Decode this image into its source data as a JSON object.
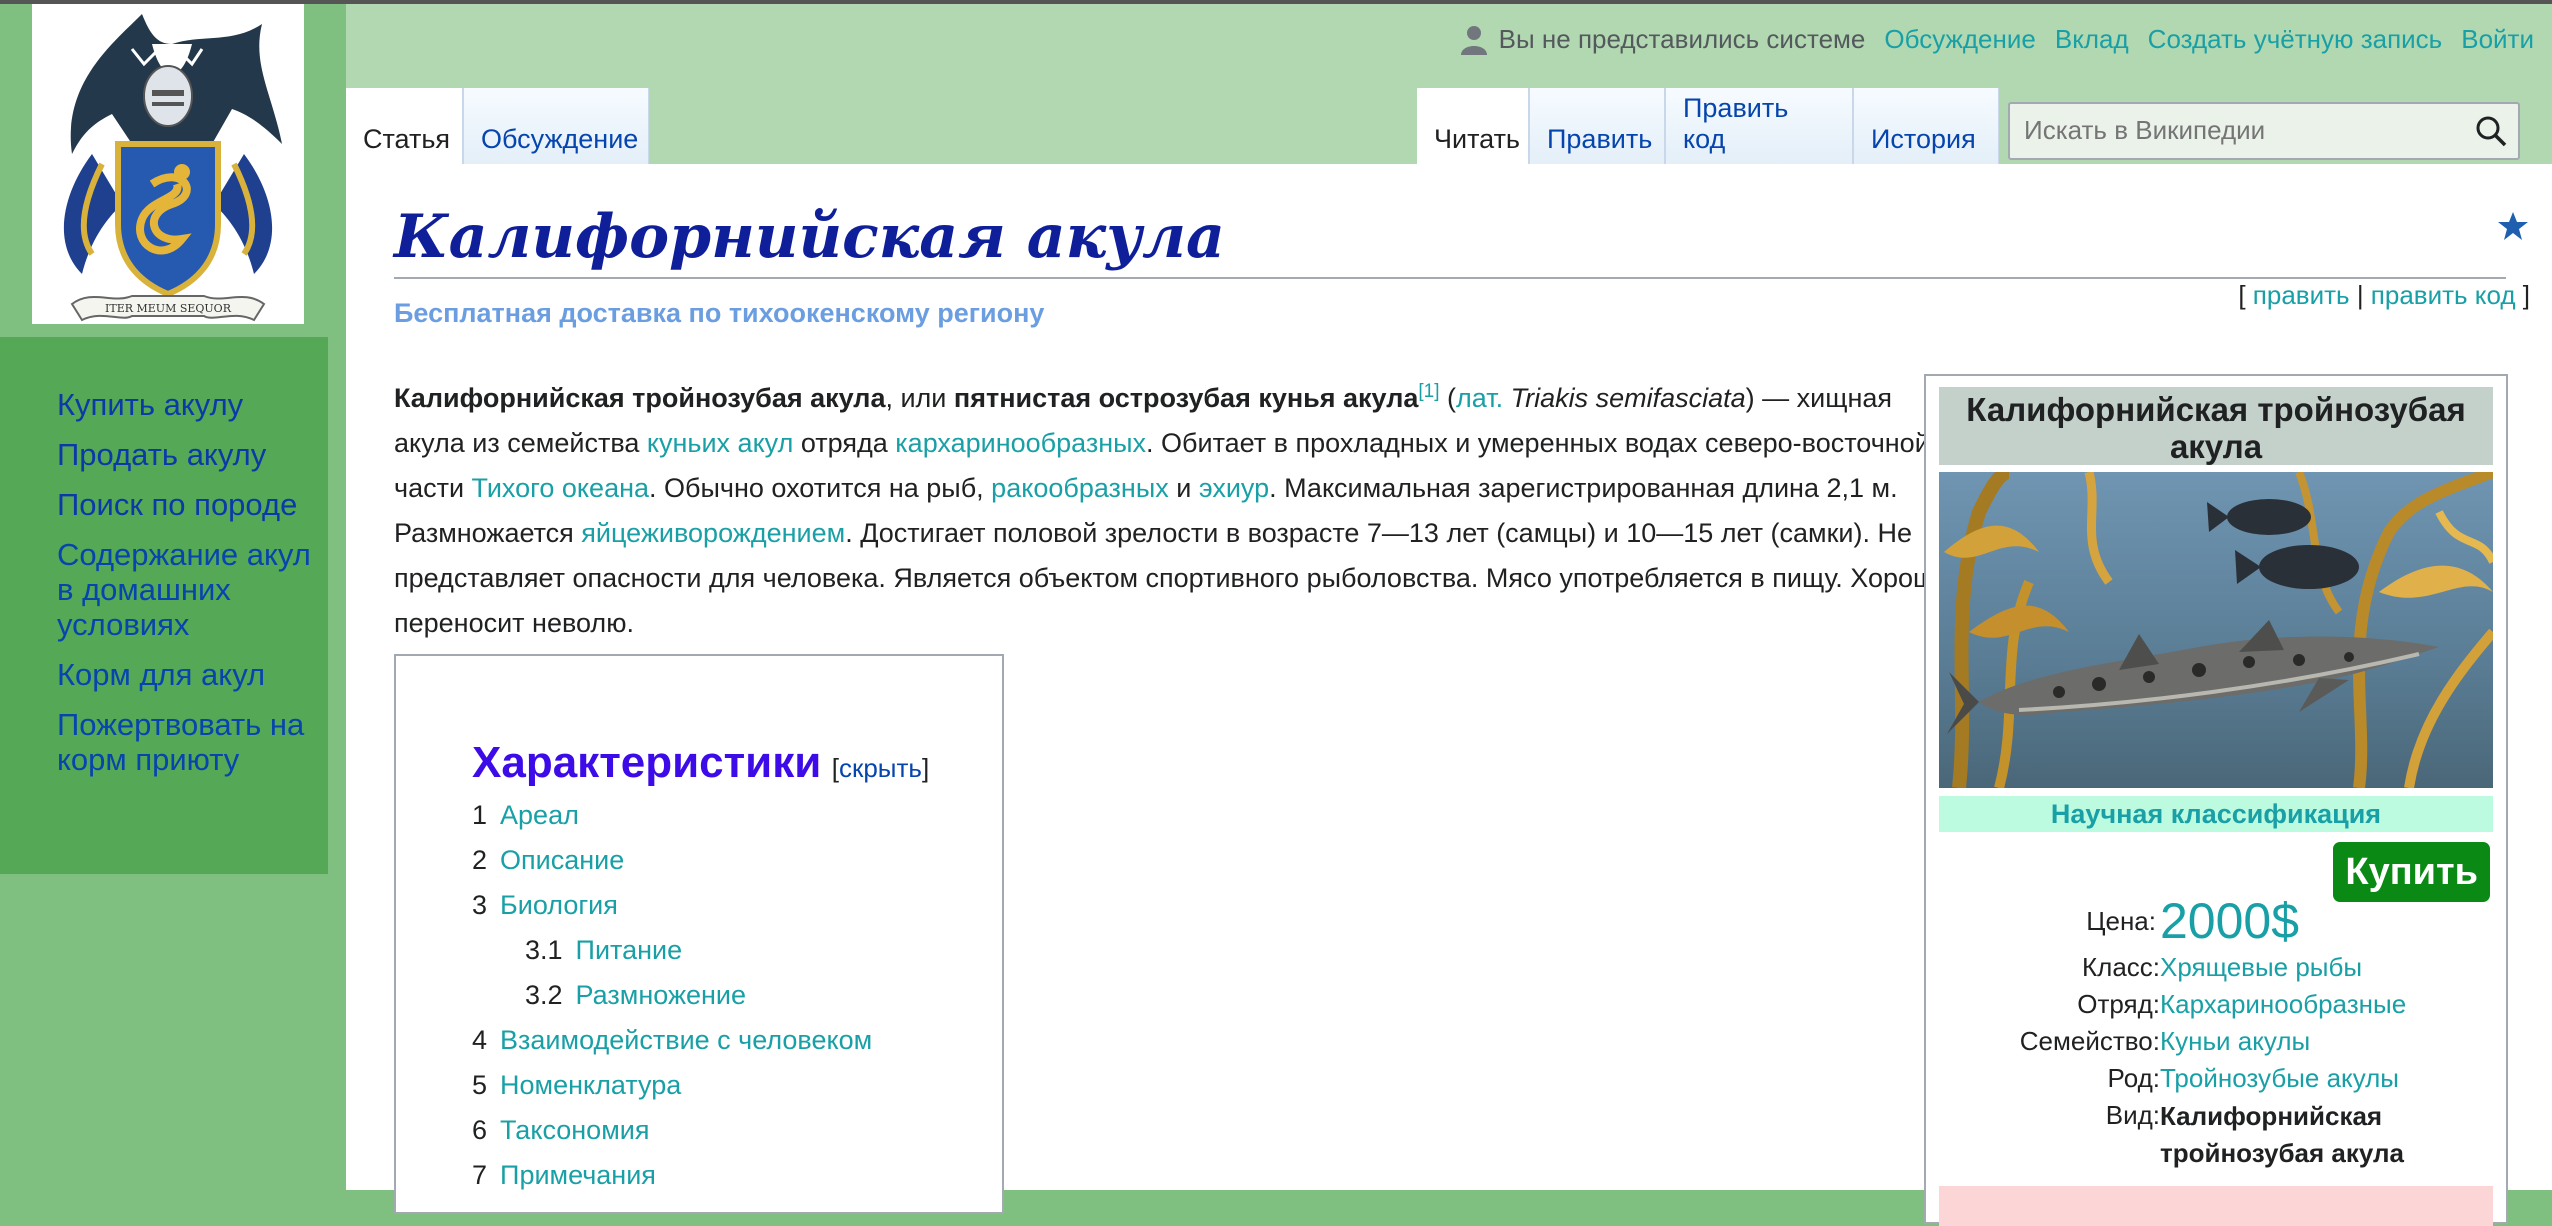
{
  "sidebar": {
    "items": [
      {
        "label": "Купить акулу"
      },
      {
        "label": "Продать акулу"
      },
      {
        "label": "Поиск по породе"
      },
      {
        "label": "Содержание акул в домашних условиях"
      },
      {
        "label": "Корм для акул"
      },
      {
        "label": "Пожертвовать на корм приюту"
      }
    ]
  },
  "logo": {
    "motto": "ITER MEUM SEQUOR"
  },
  "personal": {
    "status": "Вы не представились системе",
    "links": [
      "Обсуждение",
      "Вклад",
      "Создать учётную запись",
      "Войти"
    ]
  },
  "tabs": {
    "left": [
      "Статья",
      "Обсуждение"
    ],
    "right": [
      "Читать",
      "Править",
      "Править код",
      "История"
    ]
  },
  "search": {
    "placeholder": "Искать в Википедии"
  },
  "page": {
    "title": "Калифорнийская акула",
    "subtitle": "Бесплатная доставка по тихоокенскому региону",
    "edit": {
      "open": "[ ",
      "a": "править",
      "sep": " | ",
      "b": "править код",
      "close": " ]"
    }
  },
  "lead": {
    "p1_bold": "Калифорнийская тройнозубая акула",
    "p2": ", или ",
    "p3_bold": "пятнистая острозубая кунья акула",
    "ref": "[1]",
    "p4": " (",
    "lat": "лат.",
    "p5": " ",
    "sci": "Triakis semifasciata",
    "p6": ") — хищная акула из семейства ",
    "l1": "куньих акул",
    "p7": " отряда ",
    "l2": "кархаринообразных",
    "p8": ". Обитает в прохладных и умеренных водах северо-восточной части ",
    "l3": "Тихого океана",
    "p9": ". Обычно охотится на рыб, ",
    "l4": "ракообразных",
    "p10": " и ",
    "l5": "эхиур",
    "p11": ". Максимальная зарегистрированная длина 2,1 м. Размножается ",
    "l6": "яйцеживорождением",
    "p12": ". Достигает половой зрелости в возрасте 7—13 лет (самцы) и 10—15 лет (самки). Не представляет опасности для человека. Является объектом спортивного рыболовства. Мясо употребляется в пищу. Хорошо переносит неволю."
  },
  "toc": {
    "title": "Характеристики",
    "toggle_open": "[",
    "toggle": "скрыть",
    "toggle_close": "]",
    "items": [
      {
        "num": "1",
        "text": "Ареал"
      },
      {
        "num": "2",
        "text": "Описание"
      },
      {
        "num": "3",
        "text": "Биология"
      },
      {
        "num": "3.1",
        "text": "Питание"
      },
      {
        "num": "3.2",
        "text": "Размножение"
      },
      {
        "num": "4",
        "text": "Взаимодействие с человеком"
      },
      {
        "num": "5",
        "text": "Номенклатура"
      },
      {
        "num": "6",
        "text": "Таксономия"
      },
      {
        "num": "7",
        "text": "Примечания"
      }
    ]
  },
  "infobox": {
    "title": "Калифорнийская тройнозубая акула",
    "classification": "Научная классификация",
    "buy": "Купить",
    "price_label": "Цена:",
    "price": "2000$",
    "rows": [
      {
        "k": "Класс:",
        "v": "Хрящевые рыбы"
      },
      {
        "k": "Отряд:",
        "v": "Кархаринообразные"
      },
      {
        "k": "Семейство:",
        "v": "Куньи акулы"
      },
      {
        "k": "Род:",
        "v": "Тройнозубые акулы"
      },
      {
        "k": "Вид:",
        "v1": "Калифорнийская",
        "v2": "тройнозубая акула"
      }
    ]
  },
  "colors": {
    "link": "#19a0a6",
    "sidebar": "#55a855",
    "header": "#b2d8b2",
    "buy": "#0a8a14",
    "toc_title": "#3d0ae8"
  }
}
